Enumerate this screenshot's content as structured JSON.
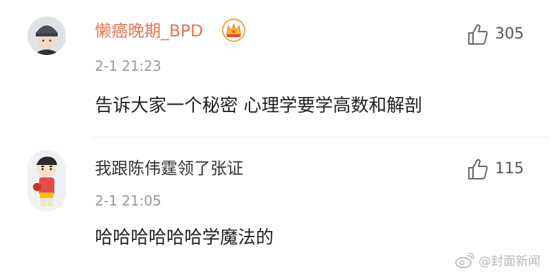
{
  "comments": [
    {
      "username": "懒癌晚期_BPD",
      "time": "2-1 21:23",
      "text": "告诉大家一个秘密 心理学要学高数和解剖",
      "likes": "305",
      "avatar_icon": "user-avatar-beanie-icon",
      "badge_icon": "crown-badge-icon"
    },
    {
      "username": "我跟陈伟霆领了张证",
      "time": "2-1 21:05",
      "text": "哈哈哈哈哈哈学魔法的",
      "likes": "115",
      "avatar_icon": "cartoon-avatar-icon"
    }
  ],
  "watermark": {
    "text": "@封面新闻",
    "icon": "weibo-logo-icon"
  },
  "colors": {
    "username_highlight": "#eb7350",
    "muted_text": "#999999",
    "body_text": "#222222"
  }
}
